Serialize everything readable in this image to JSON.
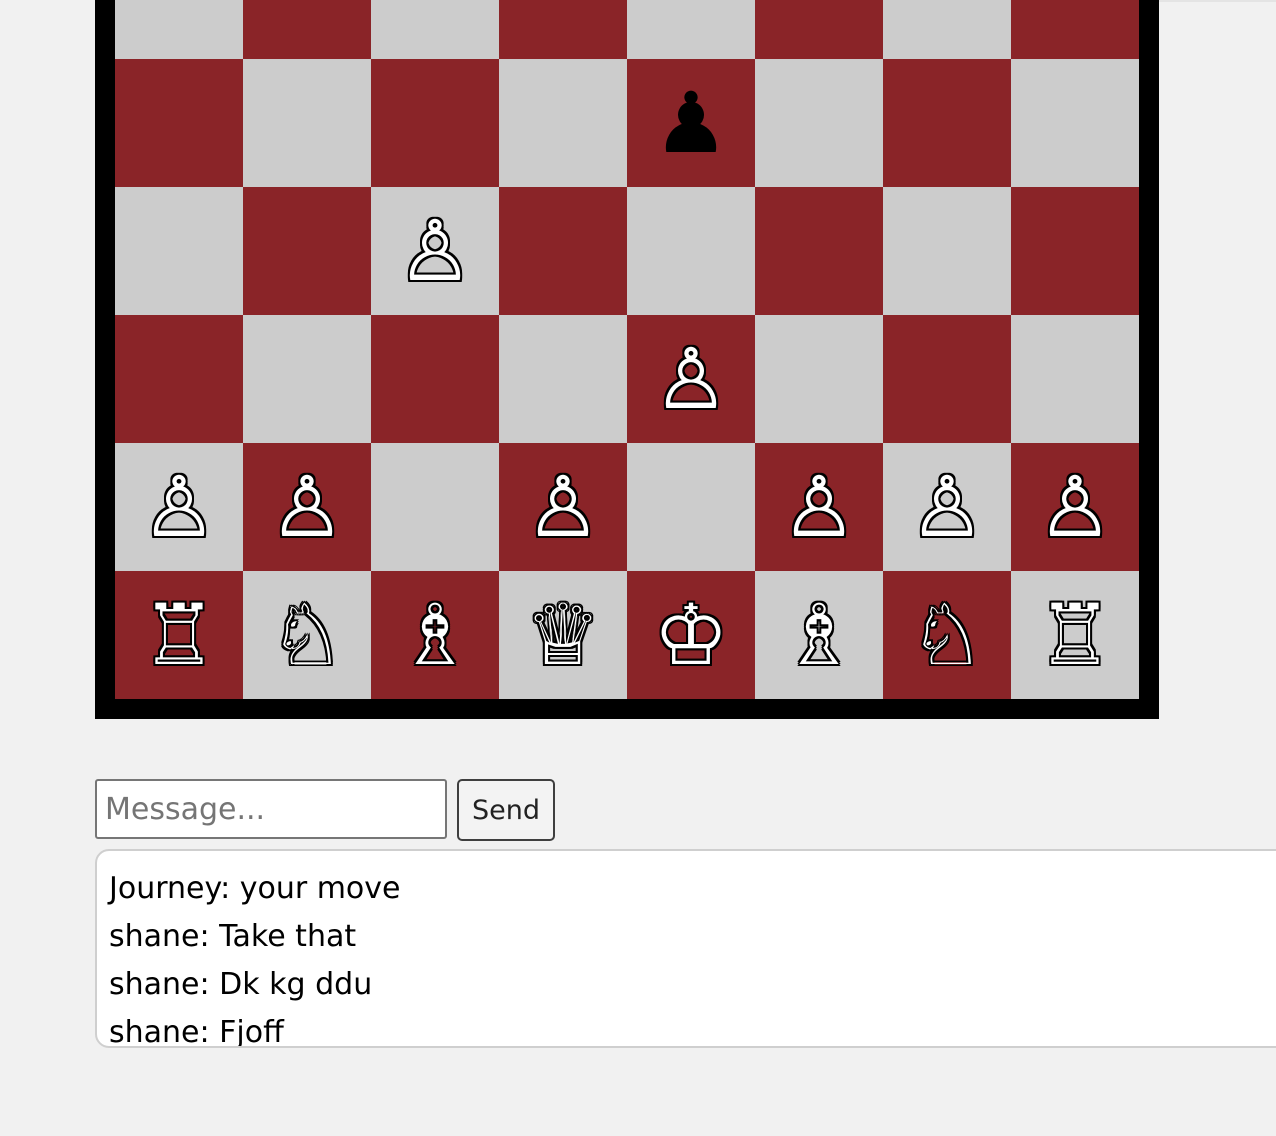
{
  "board": {
    "colors": {
      "light": "#cccccc",
      "dark": "#8a2428",
      "frame": "#000000"
    },
    "rows": [
      [
        "",
        "",
        "",
        "",
        "",
        "",
        "",
        ""
      ],
      [
        "",
        "",
        "",
        "",
        "♟",
        "",
        "",
        ""
      ],
      [
        "",
        "",
        "♙",
        "",
        "",
        "",
        "",
        ""
      ],
      [
        "",
        "",
        "",
        "",
        "♙",
        "",
        "",
        ""
      ],
      [
        "♙",
        "♙",
        "",
        "♙",
        "",
        "♙",
        "♙",
        "♙"
      ],
      [
        "♖",
        "♘",
        "♗",
        "♕",
        "♔",
        "♗",
        "♘",
        "♖"
      ]
    ],
    "piece_names": {
      "♙": "white-pawn",
      "♖": "white-rook",
      "♘": "white-knight",
      "♗": "white-bishop",
      "♕": "white-queen",
      "♔": "white-king",
      "♟": "black-pawn"
    }
  },
  "chat": {
    "input_placeholder": "Message...",
    "input_value": "",
    "send_label": "Send",
    "messages": [
      "Journey: your move",
      "shane: Take that",
      "shane: Dk kg ddu",
      "shane: Fjoff"
    ]
  }
}
